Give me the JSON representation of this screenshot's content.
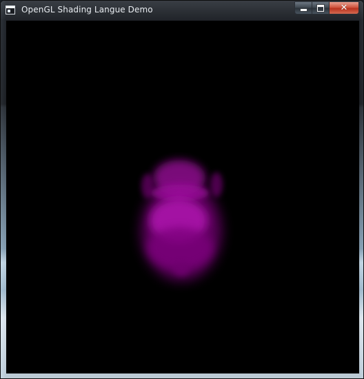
{
  "window": {
    "title": "OpenGL Shading Langue Demo",
    "icon": "opengl-app-icon"
  },
  "caption_buttons": {
    "minimize_icon": "minimize-icon",
    "maximize_icon": "maximize-icon",
    "close_glyph": "✕"
  },
  "scene": {
    "background_color": "#000000",
    "object_color": "#8e0a8e",
    "highlight_color": "#b012b0"
  }
}
